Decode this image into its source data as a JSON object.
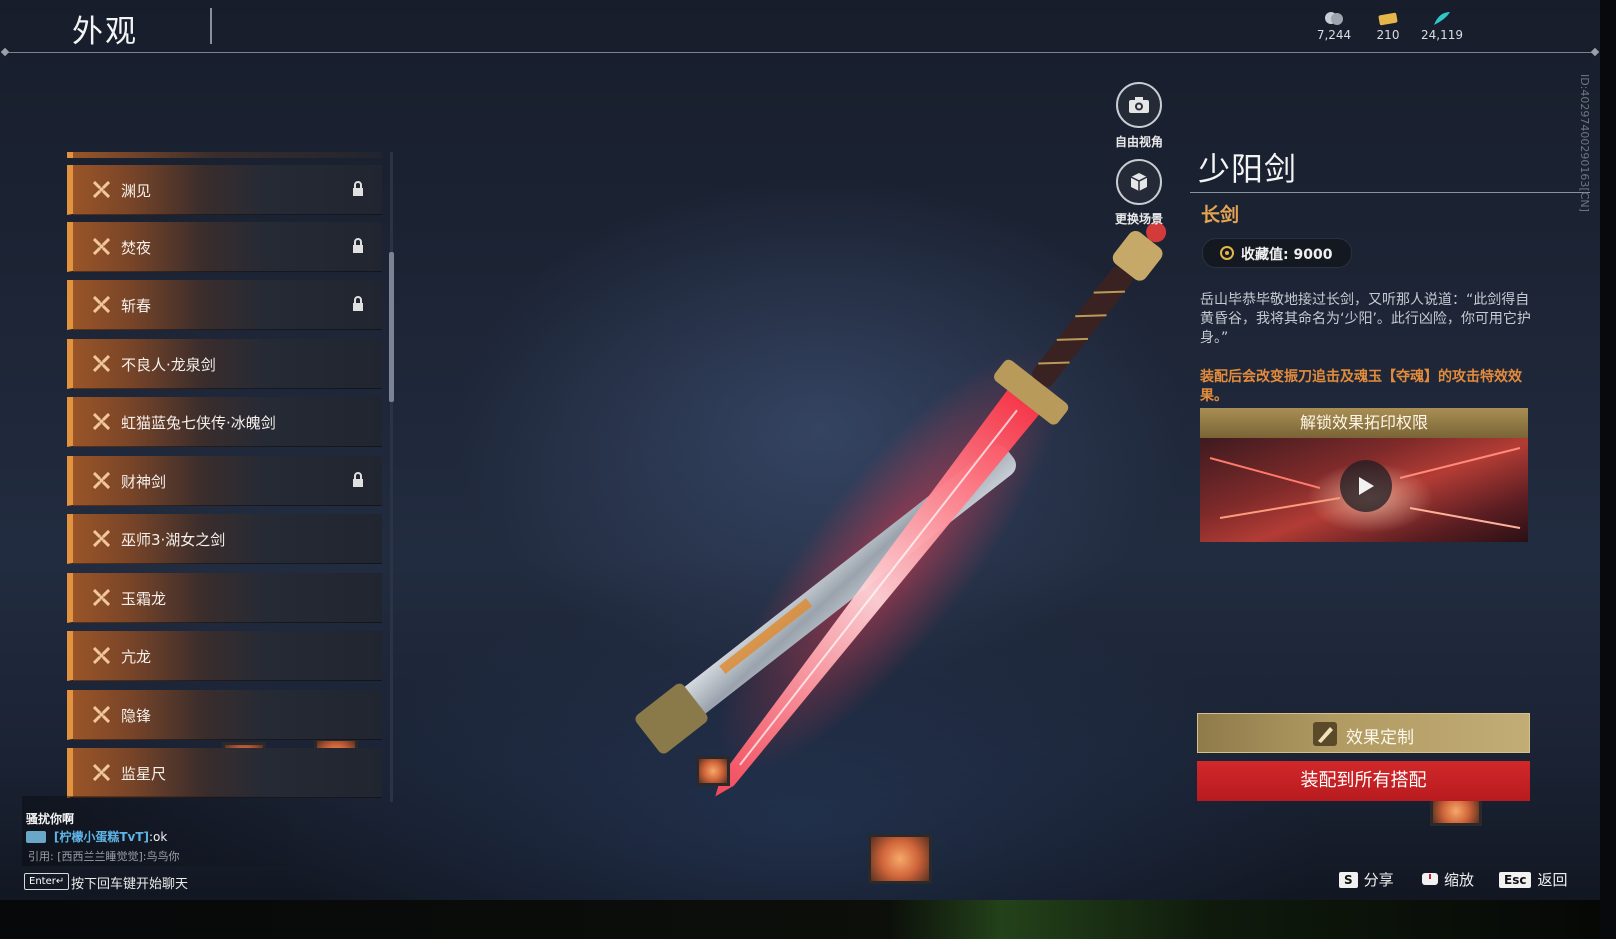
{
  "header": {
    "title": "外观",
    "currencies": [
      {
        "icon": "coin-bag-icon",
        "value": "7,244",
        "color": "#c9cdd4"
      },
      {
        "icon": "gold-ticket-icon",
        "value": "210",
        "color": "#e5b64a"
      },
      {
        "icon": "jade-feather-icon",
        "value": "24,119",
        "color": "#2fc7c9"
      }
    ]
  },
  "list": {
    "items": [
      {
        "label": "渊见",
        "locked": true
      },
      {
        "label": "焚夜",
        "locked": true
      },
      {
        "label": "斩春",
        "locked": true
      },
      {
        "label": "不良人·龙泉剑",
        "locked": false
      },
      {
        "label": "虹猫蓝兔七侠传·冰魄剑",
        "locked": false
      },
      {
        "label": "财神剑",
        "locked": true
      },
      {
        "label": "巫师3·湖女之剑",
        "locked": false
      },
      {
        "label": "玉霜龙",
        "locked": false
      },
      {
        "label": "亢龙",
        "locked": false
      },
      {
        "label": "隐锋",
        "locked": false
      },
      {
        "label": "监星尺",
        "locked": false
      }
    ]
  },
  "side_buttons": {
    "free_view": "自由视角",
    "change_scene": "更换场景"
  },
  "detail": {
    "name": "少阳剑",
    "type": "长剑",
    "collect_label": "收藏值: 9000",
    "description": "岳山毕恭毕敬地接过长剑，又听那人说道：“此剑得自黄昏谷，我将其命名为‘少阳’。此行凶险，你可用它护身。”",
    "effect_note": "装配后会改变振刀追击及魂玉【夺魂】的攻击特效效果。",
    "unlock_title": "解锁效果拓印权限",
    "custom_button": "效果定制",
    "equip_button": "装配到所有搭配",
    "id_text": "ID:40297400290163[CN]"
  },
  "chat": {
    "line1": "骚扰你啊",
    "line2_name": "[柠檬小蛋糕TvT]",
    "line2_msg": ":ok",
    "line3": "引用: [西西兰兰睡觉觉]:鸟鸟你",
    "enter_key": "Enter↵",
    "hint": "按下回车键开始聊天"
  },
  "hotkeys": [
    {
      "key": "S",
      "label": "分享"
    },
    {
      "key": "",
      "label": "缩放"
    },
    {
      "key": "Esc",
      "label": "返回"
    }
  ],
  "colors": {
    "accent_orange": "#e3923d",
    "equip_red": "#c8202a",
    "gold_button": "#b09a62"
  }
}
